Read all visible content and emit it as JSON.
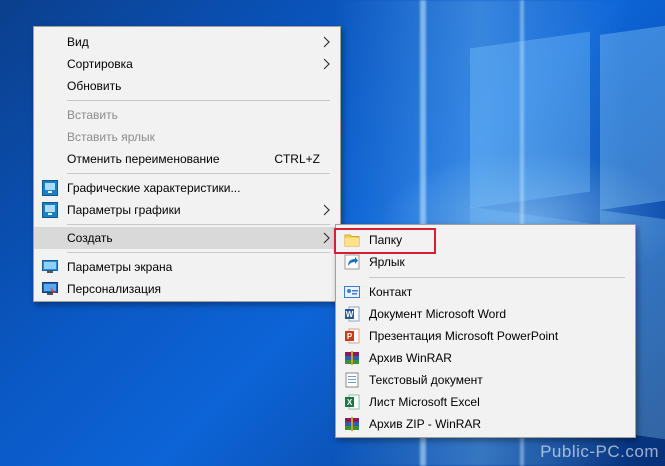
{
  "context_menu": {
    "items": [
      {
        "label": "Вид",
        "has_submenu": true,
        "disabled": false
      },
      {
        "label": "Сортировка",
        "has_submenu": true,
        "disabled": false
      },
      {
        "label": "Обновить",
        "has_submenu": false,
        "disabled": false
      },
      {
        "label": "Вставить",
        "has_submenu": false,
        "disabled": true
      },
      {
        "label": "Вставить ярлык",
        "has_submenu": false,
        "disabled": true
      },
      {
        "label": "Отменить переименование",
        "shortcut": "CTRL+Z",
        "has_submenu": false,
        "disabled": false
      },
      {
        "label": "Графические характеристики...",
        "icon": "graphics-icon",
        "has_submenu": false,
        "disabled": false
      },
      {
        "label": "Параметры графики",
        "icon": "graphics-icon",
        "has_submenu": true,
        "disabled": false
      },
      {
        "label": "Создать",
        "has_submenu": true,
        "disabled": false,
        "hovered": true
      },
      {
        "label": "Параметры экрана",
        "icon": "display-icon",
        "has_submenu": false,
        "disabled": false
      },
      {
        "label": "Персонализация",
        "icon": "personalize-icon",
        "has_submenu": false,
        "disabled": false
      }
    ]
  },
  "create_submenu": {
    "items": [
      {
        "label": "Папку",
        "icon": "folder-icon",
        "highlighted": true
      },
      {
        "label": "Ярлык",
        "icon": "shortcut-icon"
      },
      {
        "label": "Контакт",
        "icon": "contact-icon"
      },
      {
        "label": "Документ Microsoft Word",
        "icon": "word-icon"
      },
      {
        "label": "Презентация Microsoft PowerPoint",
        "icon": "powerpoint-icon"
      },
      {
        "label": "Архив WinRAR",
        "icon": "winrar-icon"
      },
      {
        "label": "Текстовый документ",
        "icon": "text-doc-icon"
      },
      {
        "label": "Лист Microsoft Excel",
        "icon": "excel-icon"
      },
      {
        "label": "Архив ZIP - WinRAR",
        "icon": "winrar-zip-icon"
      }
    ]
  },
  "watermark": "Public-PC.com",
  "colors": {
    "highlight": "#d6202e",
    "menu_bg": "#f2f2f2",
    "hover_bg": "#d9d9d9"
  }
}
